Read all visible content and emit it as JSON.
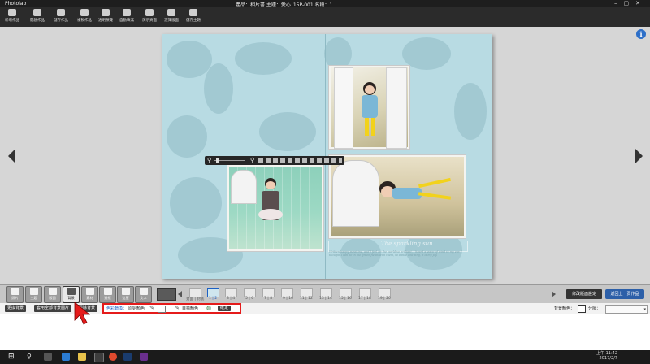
{
  "app": {
    "logo": "Photolab",
    "title": "產品：相片書  主題：愛心_15P-001  名稱：1"
  },
  "toolbar": [
    {
      "label": "新增作品",
      "icon": "new-file-icon"
    },
    {
      "label": "開啟作品",
      "icon": "folder-icon"
    },
    {
      "label": "儲存作品",
      "icon": "save-icon"
    },
    {
      "label": "複製作品",
      "icon": "copy-icon"
    },
    {
      "label": "透明預覽",
      "icon": "sun-icon"
    },
    {
      "label": "自動填滿",
      "icon": "eye-icon"
    },
    {
      "label": "演示頁面",
      "icon": "present-icon"
    },
    {
      "label": "選擇版面",
      "icon": "person-icon"
    },
    {
      "label": "儲存主題",
      "icon": "save-theme-icon"
    }
  ],
  "album": {
    "caption": "The sparkling sun",
    "caption_body": "Written happy sunshine, and I feel on the world so brilliant, I heard a voice of wind in my ear. I thought I can be in the green fields with them, to dance and sing, it is my joy."
  },
  "tabs": [
    {
      "label": "照片",
      "icon": "photo-icon"
    },
    {
      "label": "主題",
      "icon": "heart-icon"
    },
    {
      "label": "版面",
      "icon": "layout-icon"
    },
    {
      "label": "背景",
      "icon": "background-icon"
    },
    {
      "label": "素材",
      "icon": "material-icon"
    },
    {
      "label": "邊框",
      "icon": "frame-icon"
    },
    {
      "label": "遮罩",
      "icon": "mask-icon"
    },
    {
      "label": "文字",
      "icon": "text-icon"
    }
  ],
  "pages": [
    "封面 | 封底",
    "1 | 2",
    "3 | 4",
    "5 | 6",
    "7 | 8",
    "9 | 10",
    "11 | 12",
    "13 | 14",
    "15 | 16",
    "17 | 18",
    "19 | 20"
  ],
  "current_page": "1 | 2",
  "arrange_btn": "修改版面設定",
  "back_btn": "返回上一頁作品",
  "toolrow": {
    "btn1": "更換背景",
    "btn2": "套用全部背景圖片",
    "btn3": "清除背景",
    "color_change": "色彩轉換：",
    "orig_color": "原始顏色",
    "target_color": "目標顏色",
    "ok": "確定",
    "bg_color": "背景顏色：",
    "divider": "分隔："
  },
  "taskbar": {
    "time": "上午 11:42",
    "date": "2017/2/7"
  },
  "colors": {
    "album_bg": "#b8dbe3",
    "highlight": "#e51b1b",
    "accent": "#2c5fa8"
  }
}
